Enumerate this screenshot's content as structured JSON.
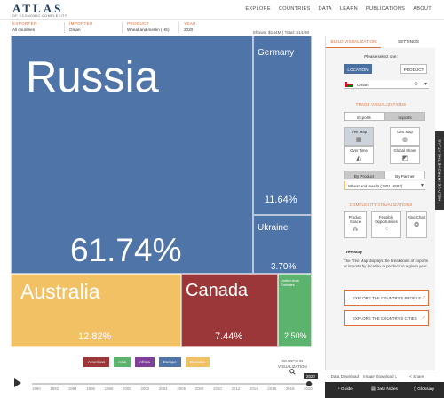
{
  "header": {
    "logo": "ATLAS",
    "logo_sub": "OF ECONOMIC COMPLEXITY",
    "nav": [
      "EXPLORE",
      "COUNTRIES",
      "DATA",
      "LEARN",
      "PUBLICATIONS",
      "ABOUT"
    ]
  },
  "query": {
    "exporter_label": "EXPORTER",
    "exporter": "All countries",
    "importer_label": "IMPORTER",
    "importer": "Oman",
    "product_label": "PRODUCT",
    "product": "Wheat and meslin (HS)",
    "year_label": "YEAR",
    "year": "2020",
    "shown_label": "Shown:",
    "shown": "$144M",
    "total_label": "Total:",
    "total": "$144M"
  },
  "treemap": {
    "cells": [
      {
        "name": "Russia",
        "pct": "61.74%",
        "region": "Europe",
        "color": "#4f74a8"
      },
      {
        "name": "Germany",
        "pct": "11.64%",
        "region": "Europe",
        "color": "#4f74a8"
      },
      {
        "name": "Ukraine",
        "pct": "3.70%",
        "region": "Europe",
        "color": "#4f74a8"
      },
      {
        "name": "Australia",
        "pct": "12.82%",
        "region": "Oceania",
        "color": "#f2c163"
      },
      {
        "name": "Canada",
        "pct": "7.44%",
        "region": "Americas",
        "color": "#9b3739"
      },
      {
        "name": "United Arab Emirates",
        "pct": "2.50%",
        "region": "Asia",
        "color": "#5cb36d"
      }
    ]
  },
  "legend": [
    {
      "label": "Americas",
      "color": "#9b3739"
    },
    {
      "label": "Asia",
      "color": "#5cb36d"
    },
    {
      "label": "Africa",
      "color": "#7e3f98"
    },
    {
      "label": "Europe",
      "color": "#4f74a8"
    },
    {
      "label": "Oceania",
      "color": "#f2c163"
    }
  ],
  "search_viz": [
    "SEARCH IN",
    "VISUALIZATION"
  ],
  "timeline": {
    "years": [
      "1990",
      "1992",
      "1994",
      "1996",
      "1998",
      "2000",
      "2002",
      "2004",
      "2006",
      "2008",
      "2010",
      "2012",
      "2014",
      "2016",
      "2018",
      "2020"
    ],
    "current": "2020",
    "progress": 1.0
  },
  "panel": {
    "tabs": [
      "BUILD VISUALIZATION",
      "SETTINGS"
    ],
    "prompt": "Please select one:",
    "location_btn": "LOCATION",
    "product_btn": "PRODUCT",
    "country": "Oman",
    "trade_heading": "TRADE VISUALIZATIONS",
    "exports_btn": "Exports",
    "imports_btn": "Imports",
    "viz": [
      "Tree Map",
      "Geo Map",
      "Over Time",
      "Global Share"
    ],
    "by_product": "By Product",
    "by_partner": "By Partner",
    "product_select": "Wheat and meslin (1001 HS92)",
    "complexity_heading": "COMPLEXITY VISUALIZATIONS",
    "complexity": [
      "Product Space",
      "Feasible Opportunities",
      "Ring Chart"
    ],
    "desc_title": "Tree Map",
    "desc": "The Tree Map displays the breakdown of exports or imports by location or product, in a given year.",
    "link1": "EXPLORE THE COUNTRY'S PROFILE",
    "link2": "EXPLORE THE COUNTRY'S CITIES"
  },
  "help_tab": "HELP US IMPROVE THE ATLAS",
  "downloads": [
    "Data Download",
    "Image Download",
    "Share"
  ],
  "footer": [
    "Guide",
    "Data Notes",
    "Glossary"
  ]
}
